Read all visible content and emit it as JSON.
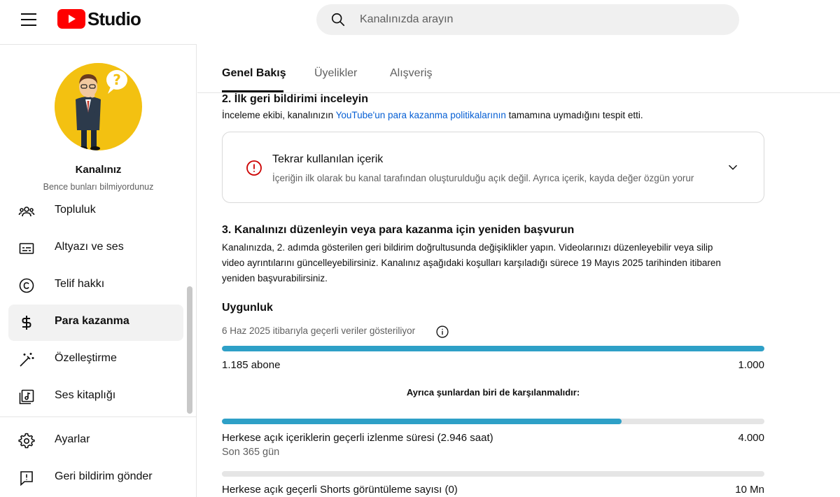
{
  "header": {
    "menu_icon": "hamburger-menu-icon",
    "logo_text": "Studio",
    "brand_color": "#ff0000",
    "search_placeholder": "Kanalınızda arayın"
  },
  "sidebar": {
    "channel_title": "Kanalınız",
    "channel_handle": "Bence bunları bilmiyordunuz",
    "items": [
      {
        "label": "Topluluk",
        "icon": "community-icon"
      },
      {
        "label": "Altyazı ve ses",
        "icon": "subtitles-icon"
      },
      {
        "label": "Telif hakkı",
        "icon": "copyright-icon"
      },
      {
        "label": "Para kazanma",
        "icon": "dollar-icon",
        "active": true
      },
      {
        "label": "Özelleştirme",
        "icon": "magic-wand-icon"
      },
      {
        "label": "Ses kitaplığı",
        "icon": "audio-library-icon"
      }
    ],
    "bottom_items": [
      {
        "label": "Ayarlar",
        "icon": "gear-icon"
      },
      {
        "label": "Geri bildirim gönder",
        "icon": "feedback-icon"
      }
    ]
  },
  "tabs": [
    {
      "label": "Genel Bakış",
      "active": true
    },
    {
      "label": "Üyelikler"
    },
    {
      "label": "Alışveriş"
    }
  ],
  "step2": {
    "heading": "2. İlk geri bildirimi inceleyin",
    "text_before": "İnceleme ekibi, kanalınızın ",
    "link": "YouTube'un para kazanma politikalarının",
    "text_after": " tamamına uymadığını tespit etti.",
    "issue": {
      "title": "Tekrar kullanılan içerik",
      "description": "İçeriğin ilk olarak bu kanal tarafından oluşturulduğu açık değil. Ayrıca içerik, kayda değer özgün yorur",
      "alert_color": "#cc0000"
    }
  },
  "step3": {
    "heading": "3. Kanalınızı düzenleyin veya para kazanma için yeniden başvurun",
    "lines": [
      "Kanalınızda, 2. adımda gösterilen geri bildirim doğrultusunda değişiklikler yapın. Videolarınızı düzenleyebilir veya silip",
      "video ayrıntılarını güncelleyebilirsiniz. Kanalınız aşağıdaki koşulları karşıladığı sürece 19 Mayıs 2025 tarihinden itibaren",
      "yeniden başvurabilirsiniz."
    ]
  },
  "eligibility": {
    "title": "Uygunluk",
    "data_note": "6 Haz 2025 itibarıyla geçerli veriler gösteriliyor",
    "progress_color": "#2ea0c7",
    "subscribers": {
      "label": "1.185 abone",
      "target": "1.000",
      "progress": 1.0
    },
    "also_required": "Ayrıca şunlardan biri de karşılanmalıdır:",
    "watch_hours": {
      "label": "Herkese açık içeriklerin geçerli izlenme süresi (2.946 saat)",
      "sub": "Son 365 gün",
      "target": "4.000",
      "progress": 0.7365
    },
    "shorts_views": {
      "label": "Herkese açık geçerli Shorts görüntüleme sayısı (0)",
      "target": "10 Mn",
      "progress": 0
    }
  }
}
